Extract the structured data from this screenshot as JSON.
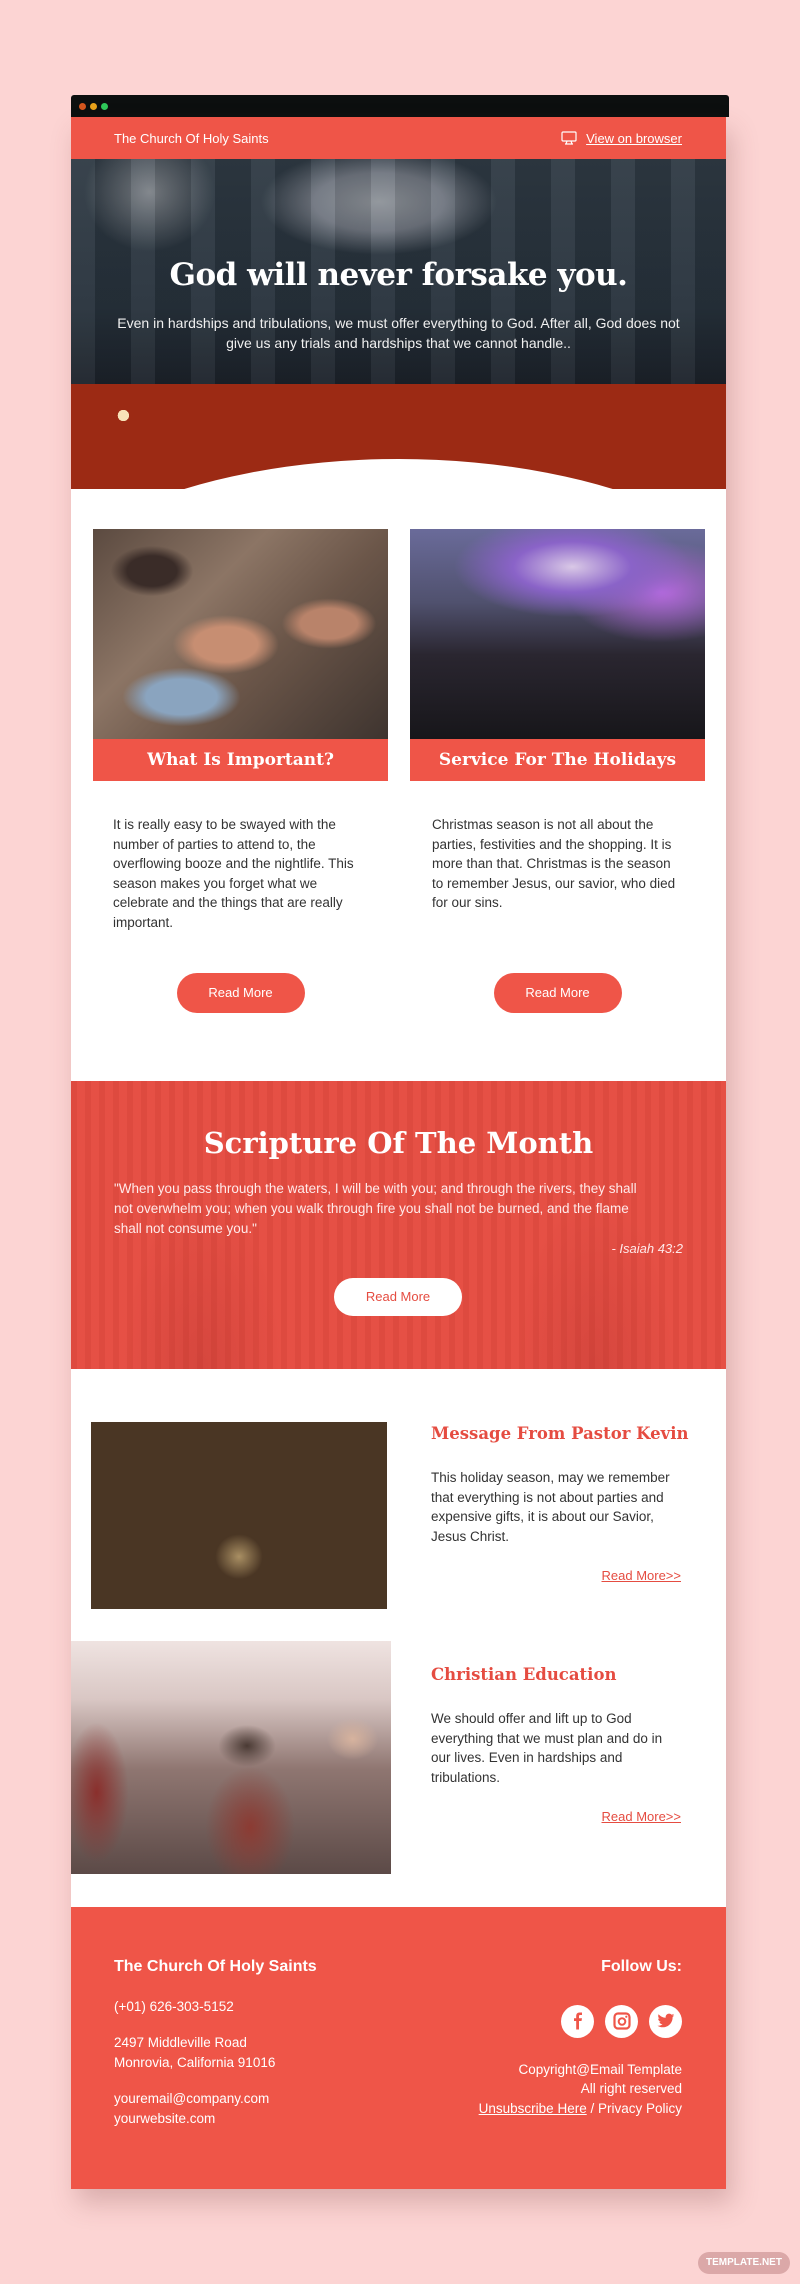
{
  "window": {
    "controls": [
      "close",
      "minimize",
      "maximize"
    ]
  },
  "topbar": {
    "brand": "The Church Of Holy Saints",
    "view_icon": "monitor-icon",
    "view_link": "View on browser"
  },
  "hero": {
    "title": "God will never forsake you.",
    "subtitle": "Even in hardships and tribulations, we must offer everything to God. After all, God does not give us any trials and hardships that we cannot handle.."
  },
  "cards": [
    {
      "title": "What Is Important?",
      "body": "It is really easy to be swayed with the number of parties to attend to, the overflowing booze and the nightlife. This season makes you forget what we celebrate and the things that are really important.",
      "button": "Read More"
    },
    {
      "title": "Service For The Holidays",
      "body": "Christmas season is not all about the parties, festivities and the shopping. It is more than that. Christmas is the season to remember Jesus, our savior, who died for our sins.",
      "button": "Read More"
    }
  ],
  "scripture": {
    "title": "Scripture Of The Month",
    "quote": "\"When you pass through the waters, I will be with you; and through the rivers, they shall not overwhelm you; when you walk through fire you shall not be burned, and the flame shall not consume you.\"",
    "reference": "- Isaiah 43:2",
    "button": "Read More"
  },
  "features": [
    {
      "title": "Message From Pastor Kevin",
      "body": "This holiday season, may we remember that everything is not about parties and expensive gifts, it is about our Savior, Jesus Christ.",
      "link": "Read More>>"
    },
    {
      "title": "Christian Education",
      "body": "We should offer and lift up to God everything that we must plan and do in our lives. Even in hardships and tribulations.",
      "link": "Read More>>"
    }
  ],
  "footer": {
    "name": "The Church Of Holy Saints",
    "phone": "(+01) 626-303-5152",
    "address_line1": "2497 Middleville Road",
    "address_line2": "Monrovia, California 91016",
    "email": "youremail@company.com",
    "website": "yourwebsite.com",
    "follow": "Follow Us:",
    "socials": [
      "facebook-icon",
      "instagram-icon",
      "twitter-icon"
    ],
    "copyright": "Copyright@Email Template",
    "rights": "All right reserved",
    "unsubscribe": "Unsubscribe Here",
    "separator": " / ",
    "privacy": "Privacy Policy"
  },
  "watermark": "TEMPLATE.NET",
  "colors": {
    "accent": "#ef5548",
    "scripture_bg": "#e54c41",
    "page_bg": "#fcd4d3"
  }
}
